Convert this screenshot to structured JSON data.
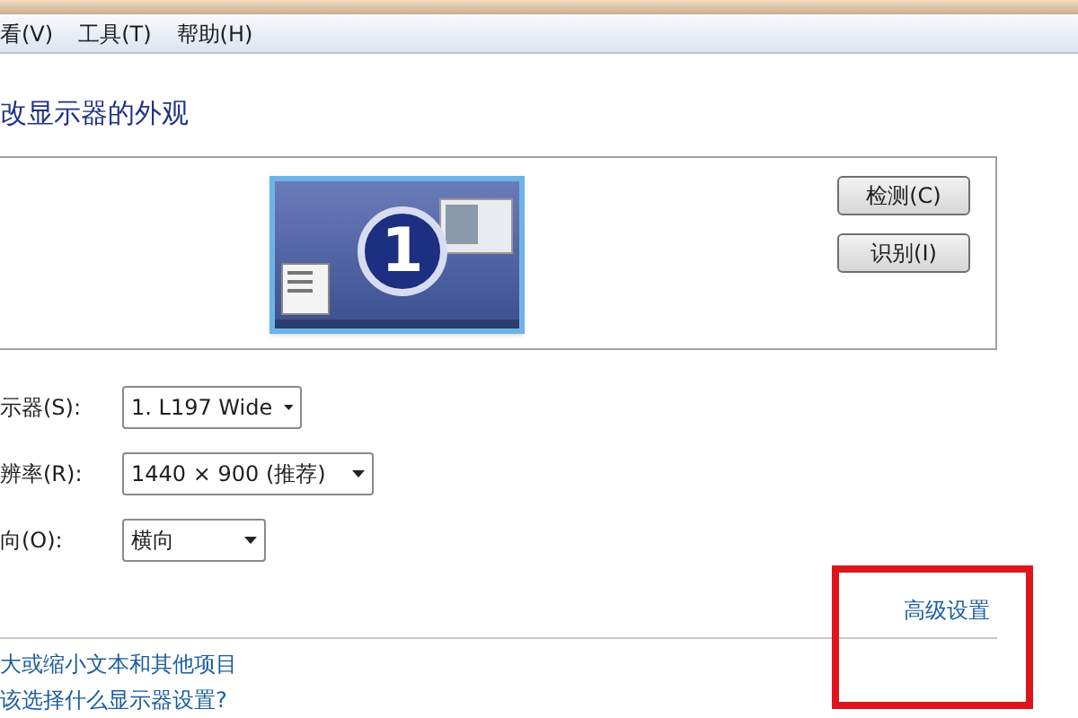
{
  "menu": [
    "看(V)",
    "工具(T)",
    "帮助(H)"
  ],
  "title": "改显示器的外观",
  "preview": {
    "monitor_number": "1",
    "buttons": [
      "检测(C)",
      "识别(I)"
    ]
  },
  "settings": [
    {
      "label": "示器(S):",
      "value": "1. L197 Wide"
    },
    {
      "label": "辨率(R):",
      "value": "1440 × 900 (推荐)"
    },
    {
      "label": "向(O):",
      "value": "横向"
    }
  ],
  "advanced_link": {
    "text": "高级设置",
    "highlighted": true
  },
  "links": [
    "大或缩小文本和其他项目",
    "该选择什么显示器设置?"
  ]
}
